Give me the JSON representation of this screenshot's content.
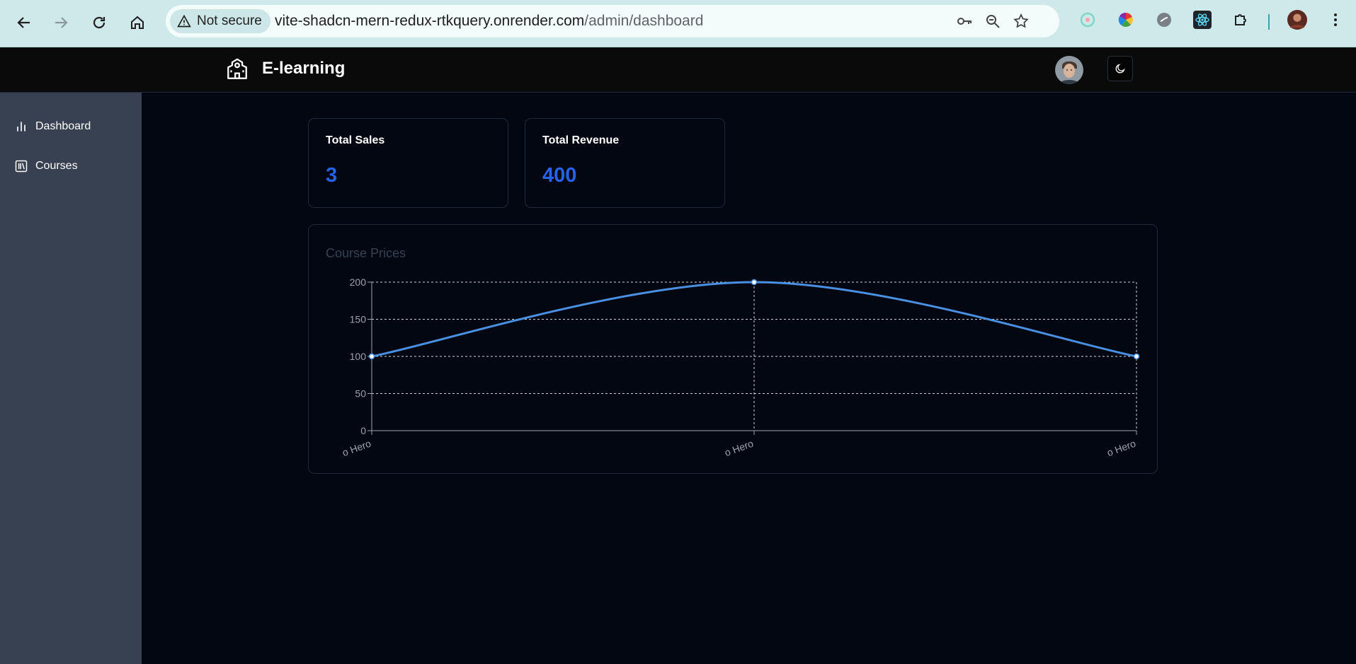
{
  "browser": {
    "security_label": "Not secure",
    "url_host": "vite-shadcn-mern-redux-rtkquery.onrender.com",
    "url_path": "/admin/dashboard"
  },
  "header": {
    "brand": "E-learning",
    "logo_icon": "school-icon",
    "theme_icon": "moon-icon"
  },
  "sidebar": {
    "items": [
      {
        "label": "Dashboard",
        "icon": "bar-chart-icon"
      },
      {
        "label": "Courses",
        "icon": "library-icon"
      }
    ]
  },
  "stats": [
    {
      "title": "Total Sales",
      "value": "3"
    },
    {
      "title": "Total Revenue",
      "value": "400"
    }
  ],
  "chart_data": {
    "type": "line",
    "title": "Course Prices",
    "categories": [
      "o Hero",
      "o Hero",
      "o Hero"
    ],
    "series": [
      {
        "values": [
          100,
          200,
          100
        ]
      }
    ],
    "yticks": [
      "0",
      "50",
      "100",
      "150",
      "200"
    ],
    "ylim": [
      0,
      200
    ],
    "grid": true,
    "line_color": "#4a90e2"
  }
}
